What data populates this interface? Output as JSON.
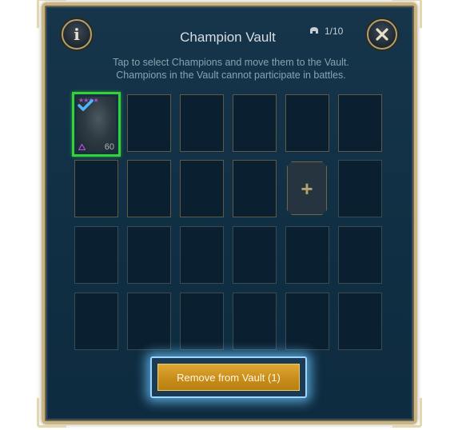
{
  "header": {
    "title": "Champion Vault",
    "counter": "1/10",
    "info_label": "i"
  },
  "description": {
    "line1": "Tap to select Champions and move them to the Vault.",
    "line2": "Champions in the Vault cannot participate in battles."
  },
  "champion": {
    "level": "60",
    "stars": "★★★★",
    "selected": true
  },
  "add_slot": {
    "label": "+"
  },
  "footer": {
    "remove_button": "Remove from Vault (1)"
  },
  "colors": {
    "selection": "#33d13a",
    "accent_gold": "#c9b583",
    "button": "#c98d1c"
  }
}
